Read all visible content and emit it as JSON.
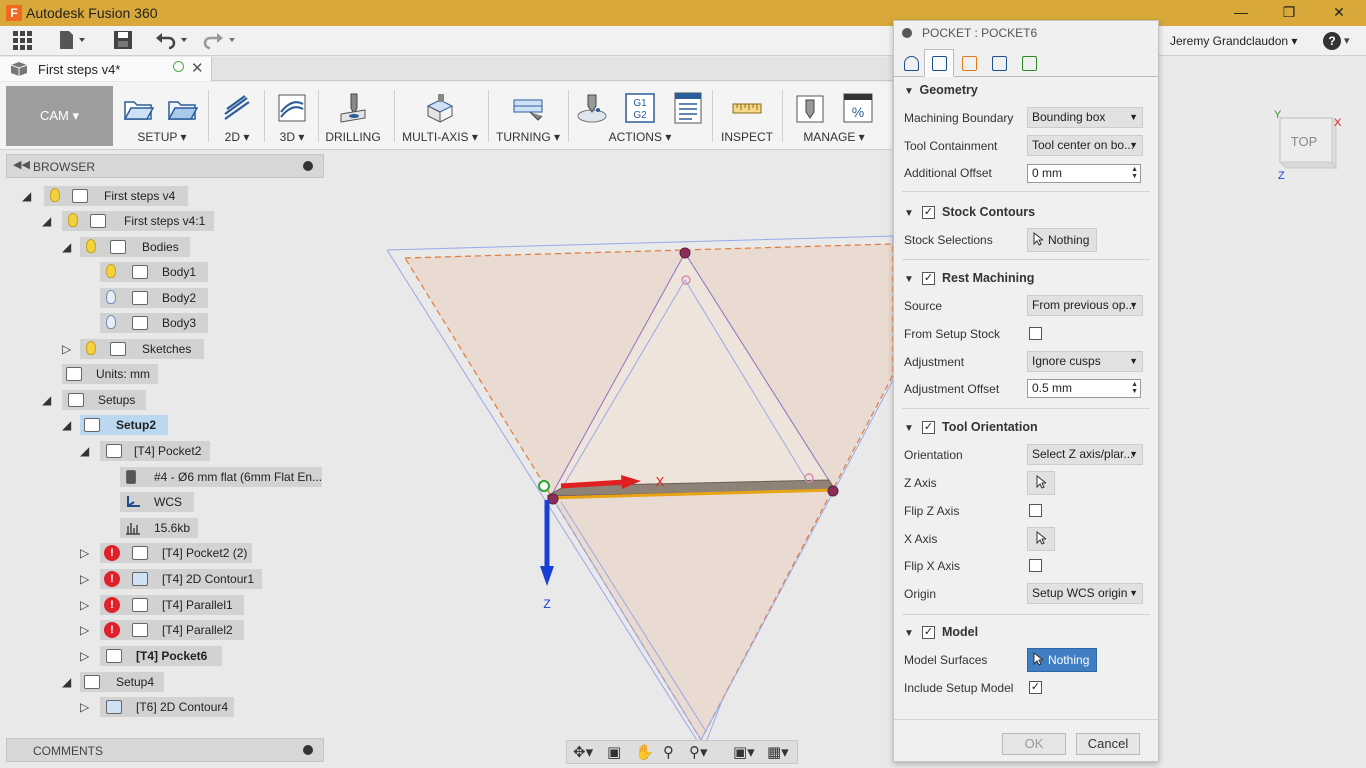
{
  "window": {
    "title": "Autodesk Fusion 360",
    "app_icon_letter": "F",
    "controls": [
      "minimize-icon",
      "maximize-icon",
      "close-icon"
    ]
  },
  "qat": {
    "icons": [
      "grid-icon",
      "file-icon",
      "save-icon",
      "undo-icon",
      "redo-icon"
    ],
    "user_name": "Jeremy Grandclaudon",
    "help_label": "?"
  },
  "document_tab": {
    "label": "First steps v4*"
  },
  "ribbon": {
    "workspace": "CAM",
    "groups": [
      {
        "label": "SETUP",
        "dropdown": true
      },
      {
        "label": "2D",
        "dropdown": true
      },
      {
        "label": "3D",
        "dropdown": true
      },
      {
        "label": "DRILLING",
        "dropdown": false
      },
      {
        "label": "MULTI-AXIS",
        "dropdown": true
      },
      {
        "label": "TURNING",
        "dropdown": true
      },
      {
        "label": "ACTIONS",
        "dropdown": true
      },
      {
        "label": "INSPECT",
        "dropdown": false
      },
      {
        "label": "MANAGE",
        "dropdown": true
      }
    ],
    "actions_g_code_label": [
      "G1",
      "G2"
    ],
    "manage_percent_label": "%"
  },
  "browser": {
    "title": "BROWSER",
    "nodes": {
      "root": "First steps v4",
      "component": "First steps v4:1",
      "bodies": "Bodies",
      "body1": "Body1",
      "body2": "Body2",
      "body3": "Body3",
      "sketches": "Sketches",
      "units": "Units: mm",
      "setups": "Setups",
      "setup2": "Setup2",
      "pocket2": "[T4] Pocket2",
      "tool": "#4 - Ø6 mm flat (6mm Flat En...",
      "wcs": "WCS",
      "nc_size": "15.6kb",
      "pocket2_2": "[T4] Pocket2 (2)",
      "contour1": "[T4] 2D Contour1",
      "parallel1": "[T4] Parallel1",
      "parallel2": "[T4] Parallel2",
      "pocket6": "[T4] Pocket6",
      "setup4": "Setup4",
      "contour4": "[T6] 2D Contour4"
    }
  },
  "comments": {
    "title": "COMMENTS"
  },
  "viewport": {
    "axis_z_label": "Z",
    "axis_x_label": "X",
    "viewcube_face": "TOP",
    "viewcube_x": "X",
    "viewcube_y": "Y",
    "viewcube_z": "Z"
  },
  "dialog": {
    "title": "POCKET : POCKET6",
    "tabs": [
      "tool-tab",
      "geometry-tab",
      "heights-tab",
      "passes-tab",
      "linking-tab"
    ],
    "geometry": {
      "header": "Geometry",
      "machining_boundary_label": "Machining Boundary",
      "machining_boundary_value": "Bounding box",
      "tool_containment_label": "Tool Containment",
      "tool_containment_value": "Tool center on bo...",
      "additional_offset_label": "Additional Offset",
      "additional_offset_value": "0 mm"
    },
    "stock_contours": {
      "header": "Stock Contours",
      "checked": true,
      "stock_selections_label": "Stock Selections",
      "stock_selections_value": "Nothing"
    },
    "rest_machining": {
      "header": "Rest Machining",
      "checked": true,
      "source_label": "Source",
      "source_value": "From previous op...",
      "from_setup_stock_label": "From Setup Stock",
      "from_setup_stock_checked": false,
      "adjustment_label": "Adjustment",
      "adjustment_value": "Ignore cusps",
      "adjustment_offset_label": "Adjustment Offset",
      "adjustment_offset_value": "0.5 mm"
    },
    "tool_orientation": {
      "header": "Tool Orientation",
      "checked": true,
      "orientation_label": "Orientation",
      "orientation_value": "Select Z axis/plar...",
      "z_axis_label": "Z Axis",
      "flip_z_label": "Flip Z Axis",
      "flip_z_checked": false,
      "x_axis_label": "X Axis",
      "flip_x_label": "Flip X Axis",
      "flip_x_checked": false,
      "origin_label": "Origin",
      "origin_value": "Setup WCS origin"
    },
    "model": {
      "header": "Model",
      "checked": true,
      "model_surfaces_label": "Model Surfaces",
      "model_surfaces_value": "Nothing",
      "include_setup_model_label": "Include Setup Model",
      "include_setup_model_checked": true
    },
    "ok_label": "OK",
    "cancel_label": "Cancel"
  },
  "colors": {
    "titlebar": "#d8a93a",
    "selection_blue": "#3f7ec2",
    "error_red": "#e0202a",
    "x_axis": "#e02020",
    "z_axis": "#1a3fd8",
    "toolpath_edge": "#e8a317"
  }
}
